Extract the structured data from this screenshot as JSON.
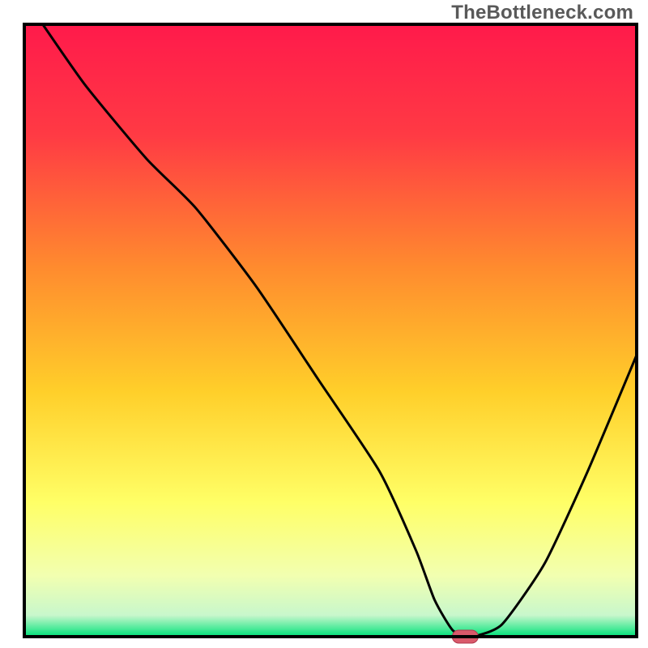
{
  "watermark": "TheBottleneck.com",
  "chart_data": {
    "type": "line",
    "title": "",
    "xlabel": "",
    "ylabel": "",
    "xlim": [
      0,
      100
    ],
    "ylim": [
      0,
      100
    ],
    "grid": false,
    "background": {
      "type": "vertical-gradient",
      "stops": [
        {
          "offset": 0.0,
          "color": "#ff1a4b"
        },
        {
          "offset": 0.18,
          "color": "#ff3a44"
        },
        {
          "offset": 0.4,
          "color": "#ff8c2e"
        },
        {
          "offset": 0.6,
          "color": "#ffcf2a"
        },
        {
          "offset": 0.78,
          "color": "#ffff66"
        },
        {
          "offset": 0.9,
          "color": "#f2ffb0"
        },
        {
          "offset": 0.965,
          "color": "#c8f7cc"
        },
        {
          "offset": 1.0,
          "color": "#00e27a"
        }
      ]
    },
    "series": [
      {
        "name": "bottleneck-curve",
        "color": "#000000",
        "x": [
          3,
          10,
          20,
          28,
          38,
          48,
          58,
          64,
          67,
          70,
          73,
          78,
          85,
          92,
          100
        ],
        "y": [
          100,
          90,
          78,
          70,
          57,
          42,
          27,
          14,
          6,
          1,
          0,
          2,
          12,
          27,
          46
        ]
      }
    ],
    "marker": {
      "name": "optimal-point",
      "x": 72,
      "y": 0,
      "fill": "#d95a6b",
      "stroke": "#b2374c"
    },
    "frame": {
      "stroke": "#000000",
      "width": 4
    }
  }
}
